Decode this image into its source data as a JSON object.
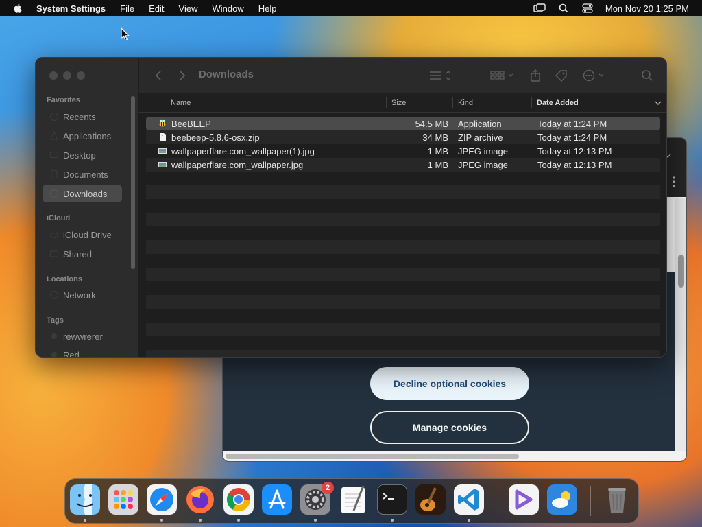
{
  "menubar": {
    "app_name": "System Settings",
    "menus": [
      "File",
      "Edit",
      "View",
      "Window",
      "Help"
    ],
    "clock": "Mon Nov 20  1:25 PM",
    "status_icons": [
      "screen-mirroring-icon",
      "spotlight-search-icon",
      "control-center-icon"
    ]
  },
  "finder": {
    "title": "Downloads",
    "sidebar": {
      "favorites_label": "Favorites",
      "favorites": [
        "Recents",
        "Applications",
        "Desktop",
        "Documents",
        "Downloads"
      ],
      "icloud_label": "iCloud",
      "icloud": [
        "iCloud Drive",
        "Shared"
      ],
      "locations_label": "Locations",
      "locations": [
        "Network"
      ],
      "tags_label": "Tags",
      "tags": [
        "rewwrerer",
        "Red"
      ],
      "selected": "Downloads"
    },
    "columns": {
      "name": "Name",
      "size": "Size",
      "kind": "Kind",
      "date": "Date Added"
    },
    "files": [
      {
        "name": "BeeBEEP",
        "size": "54.5 MB",
        "kind": "Application",
        "date": "Today at 1:24 PM",
        "icon": "bee-app-icon"
      },
      {
        "name": "beebeep-5.8.6-osx.zip",
        "size": "34 MB",
        "kind": "ZIP archive",
        "date": "Today at 1:24 PM",
        "icon": "zip-file-icon"
      },
      {
        "name": "wallpaperflare.com_wallpaper(1).jpg",
        "size": "1 MB",
        "kind": "JPEG image",
        "date": "Today at 12:13 PM",
        "icon": "image-file-icon"
      },
      {
        "name": "wallpaperflare.com_wallpaper.jpg",
        "size": "1 MB",
        "kind": "JPEG image",
        "date": "Today at 12:13 PM",
        "icon": "image-file-icon"
      }
    ],
    "selected_file": "BeeBEEP"
  },
  "browser": {
    "decline_label": "Decline optional cookies",
    "manage_label": "Manage cookies"
  },
  "dock": {
    "apps": [
      "Finder",
      "Launchpad",
      "Safari",
      "Firefox",
      "Google Chrome",
      "App Store",
      "System Settings",
      "TextEdit",
      "Terminal",
      "GarageBand",
      "Visual Studio Code",
      "Visual Studio",
      "Weather",
      "Trash"
    ],
    "settings_badge": "2"
  },
  "colors": {
    "accent_blue": "#1f4e78",
    "badge_red": "#e0443e",
    "selection_gray": "#4b4b4b"
  }
}
